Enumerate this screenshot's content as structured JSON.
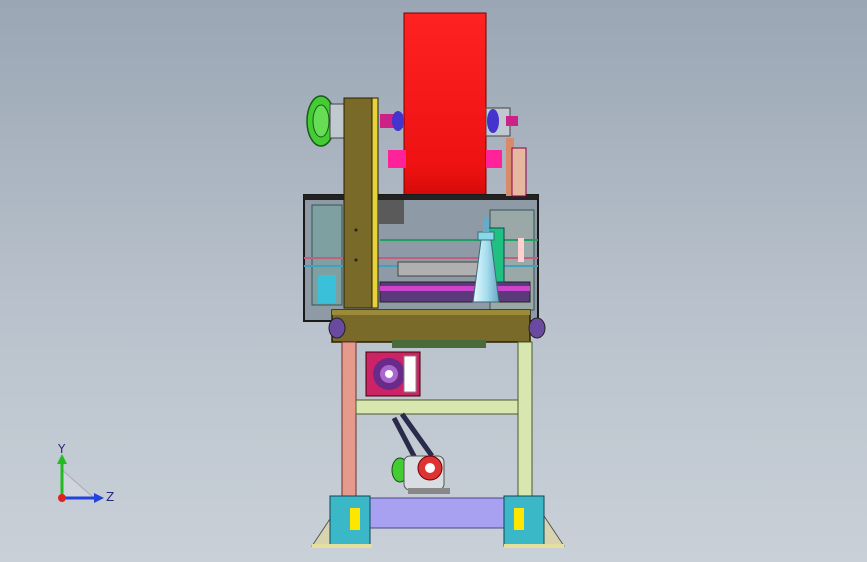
{
  "triad": {
    "y_label": "Y",
    "z_label": "Z",
    "y_color": "#22bb22",
    "z_color": "#2244dd",
    "x_color": "#dd2222"
  },
  "colors": {
    "flywheel": "#ff1a1a",
    "frame_olive": "#7a6a2a",
    "frame_yellow": "#e6d23a",
    "leg_pink": "#e69a8c",
    "leg_cream": "#d8e6b0",
    "base_lavender": "#a8a0f0",
    "pulley_green": "#44cc33",
    "pulley_magenta": "#cc2288",
    "punch_cyan": "#a8e6f0",
    "foot_teal": "#3ab8c8"
  }
}
